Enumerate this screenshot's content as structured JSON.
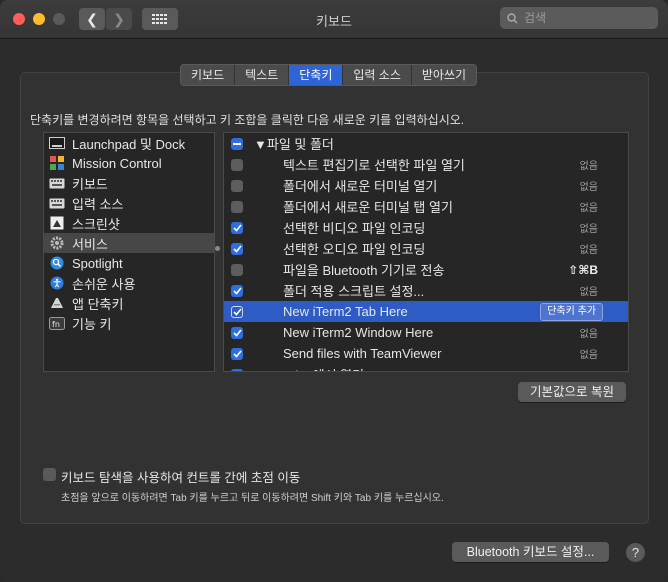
{
  "window": {
    "title": "키보드"
  },
  "search": {
    "placeholder": "검색"
  },
  "tabs": [
    {
      "label": "키보드",
      "active": false
    },
    {
      "label": "텍스트",
      "active": false
    },
    {
      "label": "단축키",
      "active": true
    },
    {
      "label": "입력 소스",
      "active": false
    },
    {
      "label": "받아쓰기",
      "active": false
    }
  ],
  "instructions": "단축키를 변경하려면 항목을 선택하고 키 조합을 클릭한 다음 새로운 키를 입력하십시오.",
  "categories": [
    {
      "label": "Launchpad 및 Dock",
      "icon": "launchpad-dock-icon"
    },
    {
      "label": "Mission Control",
      "icon": "mission-control-icon"
    },
    {
      "label": "키보드",
      "icon": "keyboard-icon"
    },
    {
      "label": "입력 소스",
      "icon": "input-source-icon"
    },
    {
      "label": "스크린샷",
      "icon": "screenshot-icon"
    },
    {
      "label": "서비스",
      "icon": "services-gear-icon",
      "selected": true
    },
    {
      "label": "Spotlight",
      "icon": "spotlight-icon"
    },
    {
      "label": "손쉬운 사용",
      "icon": "accessibility-icon"
    },
    {
      "label": "앱 단축키",
      "icon": "app-shortcuts-icon"
    },
    {
      "label": "기능 키",
      "icon": "fn-key-icon"
    }
  ],
  "shortcuts": [
    {
      "label": "▼파일 및 폴더",
      "group": true,
      "state": "mixed",
      "keys": ""
    },
    {
      "label": "텍스트 편집기로 선택한 파일 열기",
      "state": "off",
      "keys": "없음"
    },
    {
      "label": "폴더에서 새로운 터미널 열기",
      "state": "off",
      "keys": "없음"
    },
    {
      "label": "폴더에서 새로운 터미널 탭 열기",
      "state": "off",
      "keys": "없음"
    },
    {
      "label": "선택한 비디오 파일 인코딩",
      "state": "on",
      "keys": "없음"
    },
    {
      "label": "선택한 오디오 파일 인코딩",
      "state": "on",
      "keys": "없음"
    },
    {
      "label": "파일을 Bluetooth 기기로 전송",
      "state": "off",
      "keys": "⇧⌘B",
      "strong": true
    },
    {
      "label": "폴더 적용 스크립트 설정...",
      "state": "on",
      "keys": "없음"
    },
    {
      "label": "New iTerm2 Tab Here",
      "state": "on",
      "keys": "",
      "selected": true,
      "button": "단축키 추가"
    },
    {
      "label": "New iTerm2 Window Here",
      "state": "on",
      "keys": "없음"
    },
    {
      "label": "Send files with TeamViewer",
      "state": "on",
      "keys": "없음"
    },
    {
      "label": "Wi... 에서 열기",
      "state": "on",
      "keys": ""
    }
  ],
  "buttons": {
    "restore": "기본값으로 복원",
    "bluetooth": "Bluetooth 키보드 설정...",
    "help": "?"
  },
  "footer": {
    "checkbox_label": "키보드 탐색을 사용하여 컨트롤 간에 초점 이동",
    "hint": "초점을 앞으로 이동하려면 Tab 키를 누르고 뒤로 이동하려면 Shift 키와 Tab 키를 누르십시오."
  }
}
